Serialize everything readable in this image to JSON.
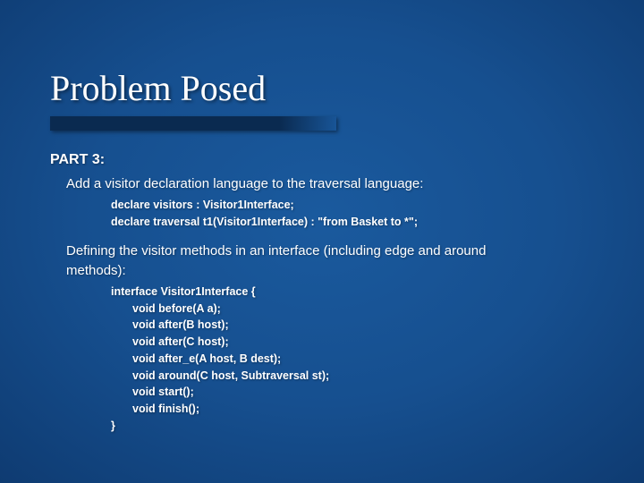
{
  "slide": {
    "title": "Problem Posed",
    "part_label": "PART 3:",
    "intro1": "Add a visitor declaration language to the traversal language:",
    "code1": {
      "l1": "declare visitors : Visitor1Interface;",
      "l2": "declare traversal t1(Visitor1Interface) : \"from Basket to *\";"
    },
    "intro2a": "Defining the visitor methods in an interface (including edge and around",
    "intro2b": "methods):",
    "code2": {
      "l1": "interface Visitor1Interface {",
      "l2": "void before(A a);",
      "l3": "void after(B host);",
      "l4": "void after(C host);",
      "l5": "void after_e(A host, B dest);",
      "l6": "void around(C host, Subtraversal st);",
      "l7": "void start();",
      "l8": "void finish();",
      "l9": "}"
    }
  }
}
